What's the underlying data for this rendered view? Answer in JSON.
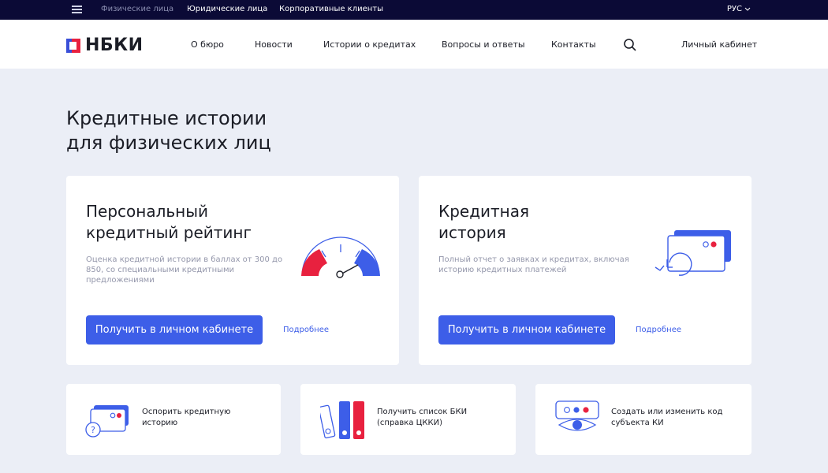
{
  "topbar": {
    "individuals": "Физические лица",
    "legal": "Юридические лица",
    "corporate": "Корпоративные клиенты",
    "language": "РУС"
  },
  "header": {
    "logo_text": "НБКИ",
    "nav": [
      "О бюро",
      "Новости",
      "Истории о кредитах",
      "Вопросы и ответы",
      "Контакты"
    ],
    "account": "Личный кабинет"
  },
  "page": {
    "title_line1": "Кредитные истории",
    "title_line2": "для физических лиц"
  },
  "cards": [
    {
      "title_line1": "Персональный",
      "title_line2": "кредитный рейтинг",
      "description": "Оценка кредитной истории в баллах от 300 до 850, со специальными кредитными предложениями",
      "button": "Получить в личном кабинете",
      "link": "Подробнее"
    },
    {
      "title_line1": "Кредитная",
      "title_line2": "история",
      "description": "Полный отчет о заявках и кредитах, включая историю кредитных платежей",
      "button": "Получить в личном кабинете",
      "link": "Подробнее"
    }
  ],
  "services": [
    {
      "label": "Оспорить кредитную историю",
      "icon": "dispute-card-icon"
    },
    {
      "label": "Получить список БКИ (справка ЦККИ)",
      "icon": "folders-icon"
    },
    {
      "label": "Создать или изменить код субъекта КИ",
      "icon": "eye-code-icon"
    }
  ],
  "colors": {
    "topbar_bg": "#0b0a36",
    "accent_blue": "#3d5ee8",
    "accent_red": "#e8213f",
    "page_bg": "#ebeef6"
  }
}
